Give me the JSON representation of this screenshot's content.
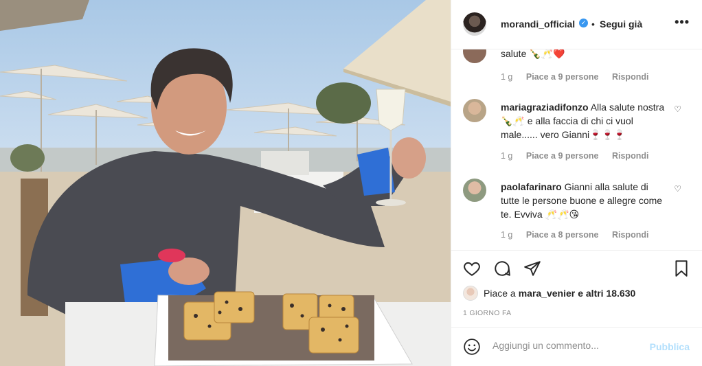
{
  "header": {
    "username": "morandi_official",
    "verified_mark": "✓",
    "separator": "•",
    "follow_status": "Segui già",
    "more": "•••"
  },
  "comments": [
    {
      "username": "",
      "text": "salute 🍾🥂❤️",
      "time": "1 g",
      "likes": "Piace a 9 persone",
      "reply": "Rispondi",
      "avatar_color": "#8b6a5a"
    },
    {
      "username": "mariagraziadifonzo",
      "text": "Alla salute nostra 🍾🥂 e alla faccia di chi ci vuol male...... vero Gianni🍷🍷🍷",
      "time": "1 g",
      "likes": "Piace a 9 persone",
      "reply": "Rispondi",
      "avatar_color": "#c9b9a0"
    },
    {
      "username": "paolafarinaro",
      "text": "Gianni alla salute di tutte le persone buone e allegre come te. Evviva 🥂🥂😘",
      "time": "1 g",
      "likes": "Piace a 8 persone",
      "reply": "Rispondi",
      "avatar_color": "#7a8a70"
    }
  ],
  "actions": {
    "like_icon": "heart-icon",
    "comment_icon": "comment-icon",
    "share_icon": "paper-plane-icon",
    "save_icon": "bookmark-icon"
  },
  "likes": {
    "prefix": "Piace a",
    "first_user": "mara_venier",
    "suffix": "e altri 18.630"
  },
  "date": "1 GIORNO FA",
  "add_comment": {
    "placeholder": "Aggiungi un commento...",
    "publish": "Pubblica"
  },
  "colors": {
    "verified": "#3897f0",
    "muted": "#8e8e8e",
    "publish_disabled": "#b2dffc",
    "text": "#262626"
  }
}
